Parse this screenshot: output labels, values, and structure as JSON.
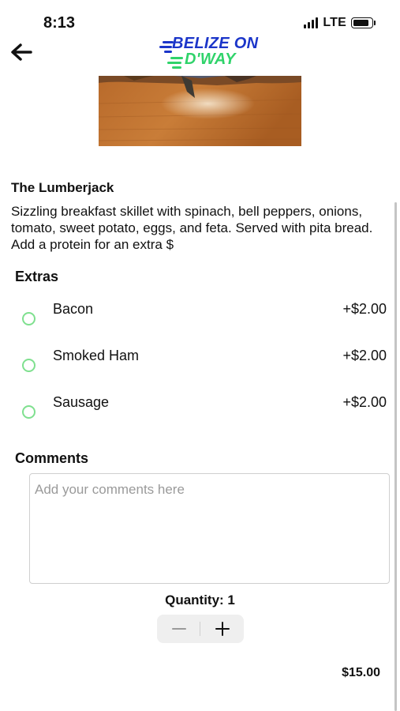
{
  "status_bar": {
    "time": "8:13",
    "network": "LTE"
  },
  "header": {
    "back_icon": "arrow-left-icon",
    "logo_line1": "BELIZE ON",
    "logo_line2": "D'WAY",
    "logo_colors": {
      "primary": "#1b35c9",
      "secondary": "#2fd36a"
    }
  },
  "item": {
    "name": "The Lumberjack",
    "description": "Sizzling breakfast skillet with spinach, bell peppers, onions, tomato, sweet potato, eggs, and feta. Served with pita bread.  Add a protein for an extra $"
  },
  "extras": {
    "title": "Extras",
    "options": [
      {
        "name": "Bacon",
        "price": "+$2.00"
      },
      {
        "name": "Smoked Ham",
        "price": "+$2.00"
      },
      {
        "name": "Sausage",
        "price": "+$2.00"
      }
    ]
  },
  "comments": {
    "title": "Comments",
    "placeholder": "Add your comments here",
    "value": ""
  },
  "quantity": {
    "label": "Quantity: 1"
  },
  "total": "$15.00",
  "colors": {
    "radio_border": "#7fe08f",
    "stepper_bg": "#efefef"
  }
}
